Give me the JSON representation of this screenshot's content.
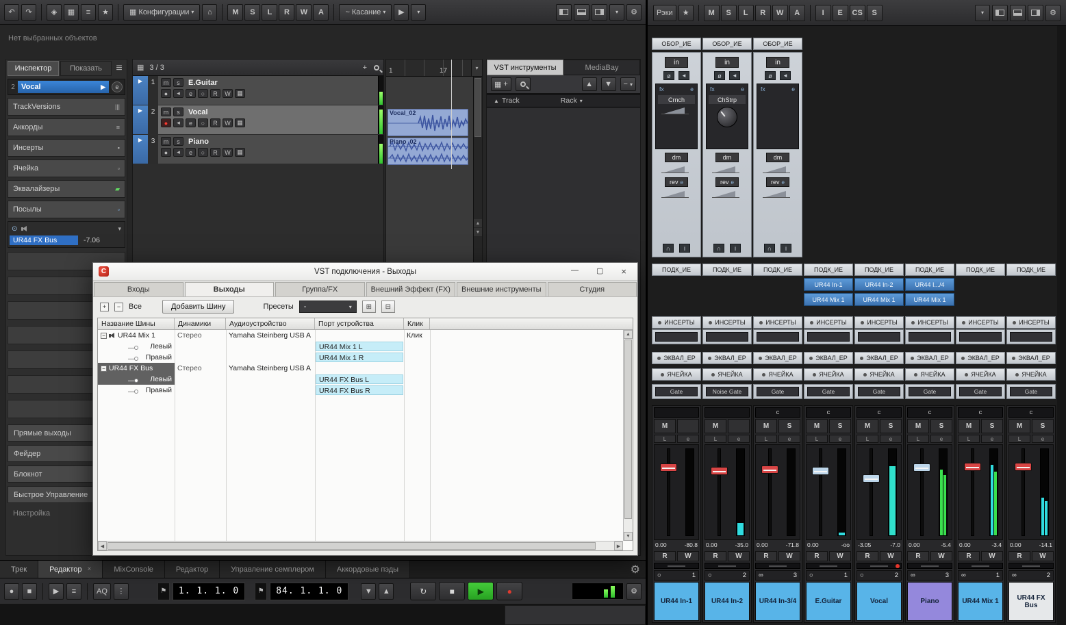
{
  "icons": {
    "undo": "↶",
    "redo": "↷",
    "pointer": "◈",
    "grid": "▦",
    "sliders": "≡",
    "star": "★",
    "home": "⌂",
    "dropdown": "▾",
    "up": "▲",
    "down": "▼",
    "left": "◀",
    "right": "▶",
    "small_left": "◂",
    "gear": "⚙",
    "plus": "+",
    "minus": "−",
    "menu": "≡",
    "close": "×",
    "minimize": "—",
    "maximize": "▢",
    "record": "●",
    "stop": "■",
    "play": "▶",
    "loop": "↻",
    "flag": "⚑",
    "circle": "○",
    "stereo": "∞",
    "collapse": "⊟",
    "expand_box": "⊞",
    "power": "⊙",
    "phase": "ø",
    "info": "i",
    "headphones": "∩",
    "wave": "~",
    "bars": "⋮"
  },
  "left_window": {
    "toolbar": {
      "configurations_label": "Конфигурации",
      "automation_letters": [
        "M",
        "S",
        "L",
        "R",
        "W",
        "A"
      ],
      "automation_mode": "Касание"
    },
    "status_text": "Нет выбранных объектов",
    "inspector": {
      "tabs": {
        "inspector": "Инспектор",
        "show": "Показать"
      },
      "track": {
        "number": "2",
        "name": "Vocal",
        "edit": "e"
      },
      "sections": [
        {
          "label": "TrackVersions",
          "icon": "|||",
          "icon_color": "#b0b0b0"
        },
        {
          "label": "Аккорды",
          "icon": "≡",
          "icon_color": "#b0b0b0"
        },
        {
          "label": "Инсерты",
          "icon": "▪",
          "icon_color": "#b0b0b0"
        },
        {
          "label": "Ячейка",
          "icon": "▫",
          "icon_color": "#b0b0b0"
        },
        {
          "label": "Эквалайзеры",
          "icon": "▰",
          "icon_color": "#62d962"
        },
        {
          "label": "Посылы",
          "icon": "▫",
          "icon_color": "#7fb2e5"
        }
      ],
      "output": {
        "bus": "UR44 FX Bus",
        "level": "-7.06"
      },
      "empty_slot_count": 7,
      "buttons": [
        "Прямые выходы",
        "Фейдер",
        "Блокнот",
        "Быстрое Управление"
      ],
      "settings_label": "Настройка"
    },
    "tracklist": {
      "count": "3 / 3",
      "button_letters": {
        "m": "m",
        "s": "s",
        "e": "e",
        "r": "R",
        "w": "W"
      },
      "tracks": [
        {
          "num": "1",
          "name": "E.Guitar",
          "selected": false,
          "record": false,
          "meter": 0.45
        },
        {
          "num": "2",
          "name": "Vocal",
          "selected": true,
          "record": true,
          "meter": 0.85
        },
        {
          "num": "3",
          "name": "Piano",
          "selected": false,
          "record": false,
          "meter": 0.7
        }
      ]
    },
    "ruler": {
      "start": "1",
      "end": "17"
    },
    "clips": [
      {
        "name": "Vocal_02"
      },
      {
        "name": "Piano_02"
      }
    ],
    "vst_panel": {
      "tabs": {
        "instruments": "VST инструменты",
        "mediabay": "MediaBay"
      },
      "track_header": "Track",
      "rack_header": "Rack"
    },
    "bottom_tabs": [
      {
        "label": "Трек",
        "close": false
      },
      {
        "label": "Редактор",
        "close": true
      },
      {
        "label": "MixConsole",
        "close": false
      },
      {
        "label": "Редактор",
        "close": false
      },
      {
        "label": "Управление семплером",
        "close": false
      },
      {
        "label": "Аккордовые пэды",
        "close": false
      }
    ],
    "transport": {
      "aq_label": "AQ",
      "position": "1.  1.  1.   0",
      "locator": "84.  1.  1.   0"
    }
  },
  "dialog": {
    "title": "VST подключения - Выходы",
    "tabs": [
      "Входы",
      "Выходы",
      "Группа/FX",
      "Внешний Эффект (FX)",
      "Внешние инструменты",
      "Студия"
    ],
    "active_tab_index": 1,
    "toolbar": {
      "all_label": "Все",
      "add_bus_label": "Добавить Шину",
      "presets_label": "Пресеты",
      "preset_value": "-"
    },
    "columns": [
      "Название Шины",
      "Динамики",
      "Аудиоустройство",
      "Порт устройства",
      "Клик"
    ],
    "rows": [
      {
        "level": 0,
        "expand": true,
        "speaker": true,
        "name": "UR44 Mix 1",
        "dyn": "Стерео",
        "device": "Yamaha Steinberg USB A",
        "port": "",
        "click": "Клик",
        "selected": false
      },
      {
        "level": 1,
        "expand": false,
        "speaker": false,
        "name": "Левый",
        "dyn": "",
        "device": "",
        "port": "UR44 Mix 1 L",
        "click": "",
        "selected": false
      },
      {
        "level": 1,
        "expand": false,
        "speaker": false,
        "name": "Правый",
        "dyn": "",
        "device": "",
        "port": "UR44 Mix 1 R",
        "click": "",
        "selected": false
      },
      {
        "level": 0,
        "expand": true,
        "speaker": false,
        "name": "UR44 FX Bus",
        "dyn": "Стерео",
        "device": "Yamaha Steinberg USB A",
        "port": "",
        "click": "",
        "selected": true
      },
      {
        "level": 1,
        "expand": false,
        "speaker": false,
        "name": "Левый",
        "dyn": "",
        "device": "",
        "port": "UR44 FX Bus L",
        "click": "",
        "selected": true
      },
      {
        "level": 1,
        "expand": false,
        "speaker": false,
        "name": "Правый",
        "dyn": "",
        "device": "",
        "port": "UR44 FX Bus R",
        "click": "",
        "selected": false
      }
    ]
  },
  "mixer": {
    "toolbar": {
      "racks_label": "Рэки",
      "letters": [
        "M",
        "S",
        "L",
        "R",
        "W",
        "A"
      ],
      "view_letters": [
        "I",
        "E",
        "CS",
        "S"
      ]
    },
    "section_headers": {
      "hardware": "ОБОР_ИЕ",
      "routing": "ПОДК_ИЕ",
      "inserts": "ИНСЕРТЫ",
      "eq": "ЭКВАЛ_ЕР",
      "strip": "ЯЧЕЙКА"
    },
    "letters": {
      "mute": "M",
      "solo": "S",
      "listen": "L",
      "edit": "e",
      "read": "R",
      "write": "W",
      "in": "in",
      "fx": "fx",
      "dm": "dm",
      "rev": "rev"
    },
    "racks": [
      {
        "fx_label": "Crnch",
        "control": "fader"
      },
      {
        "fx_label": "ChStrp",
        "control": "knob"
      },
      {
        "fx_label": "",
        "control": "none"
      }
    ],
    "channels": [
      {
        "name": "UR44 In-1",
        "number": "1",
        "type_glyph": "○",
        "pan": "",
        "gate": "Gate",
        "input": "",
        "output": "",
        "gain": "0.00",
        "peak": "-80.8",
        "fader_pos": 0.2,
        "cap": "#d84545",
        "meters": [
          0
        ],
        "meter_colors": [
          "#30dce0"
        ],
        "color": "#58b4e8",
        "solo": false,
        "record": false
      },
      {
        "name": "UR44 In-2",
        "number": "2",
        "type_glyph": "○",
        "pan": "",
        "gate": "Noise Gate",
        "input": "",
        "output": "",
        "gain": "0.00",
        "peak": "-35.0",
        "fader_pos": 0.24,
        "cap": "#d84545",
        "meters": [
          0.14
        ],
        "meter_colors": [
          "#30dce0"
        ],
        "color": "#58b4e8",
        "solo": false,
        "record": false
      },
      {
        "name": "UR44 In-3/4",
        "number": "3",
        "type_glyph": "∞",
        "pan": "c",
        "gate": "Gate",
        "input": "",
        "output": "",
        "gain": "0.00",
        "peak": "-71.8",
        "fader_pos": 0.22,
        "cap": "#d84545",
        "meters": [
          0,
          0
        ],
        "meter_colors": [
          "#30dce0",
          "#30dce0"
        ],
        "color": "#58b4e8",
        "solo": true,
        "record": false
      },
      {
        "name": "E.Guitar",
        "number": "1",
        "type_glyph": "○",
        "pan": "c",
        "gate": "Gate",
        "input": "UR44 In-1",
        "output": "UR44 Mix 1",
        "gain": "0.00",
        "peak": "-oo",
        "fader_pos": 0.24,
        "cap": "#bdd6ea",
        "meters": [
          0.03
        ],
        "meter_colors": [
          "#30dce0"
        ],
        "color": "#58b4e8",
        "solo": true,
        "record": false
      },
      {
        "name": "Vocal",
        "number": "2",
        "type_glyph": "○",
        "pan": "c",
        "gate": "Gate",
        "input": "UR44 In-2",
        "output": "UR44 Mix 1",
        "gain": "-3.05",
        "peak": "-7.0",
        "fader_pos": 0.34,
        "cap": "#bdd6ea",
        "meters": [
          0.8
        ],
        "meter_colors": [
          "#30e0cc"
        ],
        "color": "#58b4e8",
        "solo": true,
        "record": true
      },
      {
        "name": "Piano",
        "number": "3",
        "type_glyph": "∞",
        "pan": "c",
        "gate": "Gate",
        "input": "UR44 I.../4",
        "output": "UR44 Mix 1",
        "gain": "0.00",
        "peak": "-5.4",
        "fader_pos": 0.2,
        "cap": "#bdd6ea",
        "meters": [
          0.76,
          0.7
        ],
        "meter_colors": [
          "#3ae04e",
          "#3ae04e"
        ],
        "color": "#9488dc",
        "solo": true,
        "record": false
      },
      {
        "name": "UR44 Mix 1",
        "number": "1",
        "type_glyph": "∞",
        "pan": "c",
        "gate": "Gate",
        "input": "",
        "output": "",
        "gain": "0.00",
        "peak": "-3.4",
        "fader_pos": 0.19,
        "cap": "#d84545",
        "meters": [
          0.82,
          0.74
        ],
        "meter_colors": [
          "#30dce0",
          "#3ae04e"
        ],
        "color": "#58b4e8",
        "solo": true,
        "record": false
      },
      {
        "name": "UR44 FX Bus",
        "number": "2",
        "type_glyph": "∞",
        "pan": "c",
        "gate": "Gate",
        "input": "",
        "output": "",
        "gain": "0.00",
        "peak": "-14.1",
        "fader_pos": 0.19,
        "cap": "#d84545",
        "meters": [
          0.44,
          0.4
        ],
        "meter_colors": [
          "#30dce0",
          "#30dce0"
        ],
        "color": "#e6e8ea",
        "solo": true,
        "record": false
      }
    ]
  }
}
